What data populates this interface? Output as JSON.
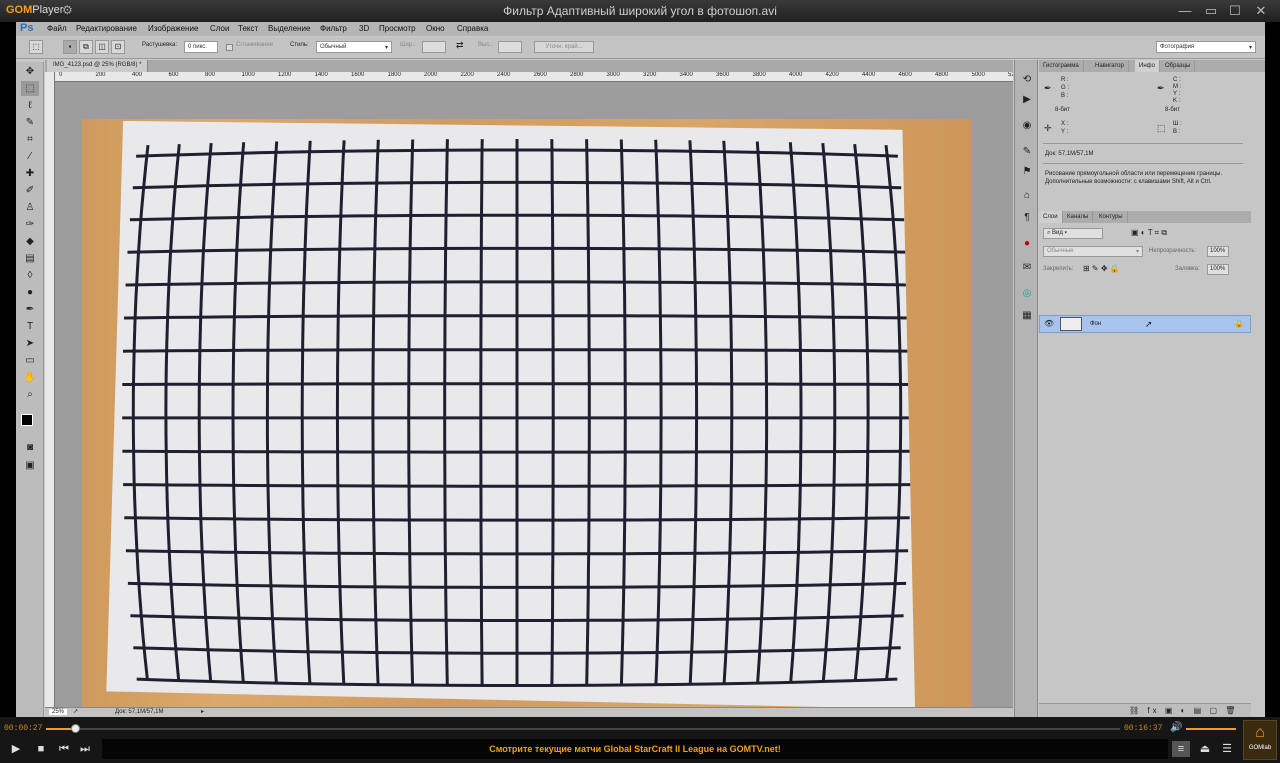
{
  "gom": {
    "logo": "GOM",
    "logo_suffix": "Player",
    "settings_icon": "gear-icon",
    "file_title": "Фильтр Адаптивный широкий угол в фотошоп.avi",
    "current_time": "00:00:27",
    "total_time": "00:16:37",
    "progress": 0.027,
    "banner": "Смотрите текущие матчи Global StarCraft II League на GOMTV.net!",
    "gomlab_label": "GOMlab"
  },
  "ps": {
    "logo": "Ps",
    "menu": [
      "Файл",
      "Редактирование",
      "Изображение",
      "Слои",
      "Текст",
      "Выделение",
      "Фильтр",
      "3D",
      "Просмотр",
      "Окно",
      "Справка"
    ],
    "options": {
      "feather_label": "Растушевка:",
      "feather_value": "0 пикс.",
      "antialias_label": "Сглаживание",
      "style_label": "Стиль:",
      "style_value": "Обычный",
      "width_label": "Шир.:",
      "height_label": "Выс.:",
      "refine_button": "Уточн. край...",
      "workspace": "Фотография"
    },
    "doc_tab": "IMG_4123.psd @ 25% (RGB/8) *",
    "ruler_labels": [
      "0",
      "200",
      "400",
      "600",
      "800",
      "1000",
      "1200",
      "1400",
      "1600",
      "1800",
      "2000",
      "2200",
      "2400",
      "2600",
      "2800",
      "3000",
      "3200",
      "3400",
      "3600",
      "3800",
      "4000",
      "4200",
      "4400",
      "4600",
      "4800",
      "5000",
      "5200"
    ],
    "zoom": "25%",
    "doc_size": "Док: 57,1M/57,1M",
    "info_panel": {
      "tabs": [
        "Гистограмма",
        "Навигатор",
        "Инфо",
        "Образцы"
      ],
      "active_tab": "Инфо",
      "rgb_labels": [
        "R :",
        "G :",
        "B :"
      ],
      "cmyk_labels": [
        "C :",
        "M :",
        "Y :",
        "K :"
      ],
      "bits_left": "8-бит",
      "bits_right": "8-бит",
      "xy_labels": [
        "X :",
        "Y :"
      ],
      "wh_labels": [
        "Ш :",
        "В :"
      ],
      "doc_size": "Док: 57,1M/57,1M",
      "hint_line1": "Рисование прямоугольной области или перемещение границы.",
      "hint_line2": "Дополнительные возможности: с клавишами Shift, Alt и Ctrl."
    },
    "layers_panel": {
      "tabs": [
        "Слои",
        "Каналы",
        "Контуры"
      ],
      "active_tab": "Слои",
      "filter_label": "Вид",
      "blend_mode": "Обычные",
      "opacity_label": "Непрозрачность:",
      "opacity_value": "100%",
      "lock_label": "Закрепить:",
      "fill_label": "Заливка:",
      "fill_value": "100%",
      "layer_name": "Фон"
    }
  }
}
